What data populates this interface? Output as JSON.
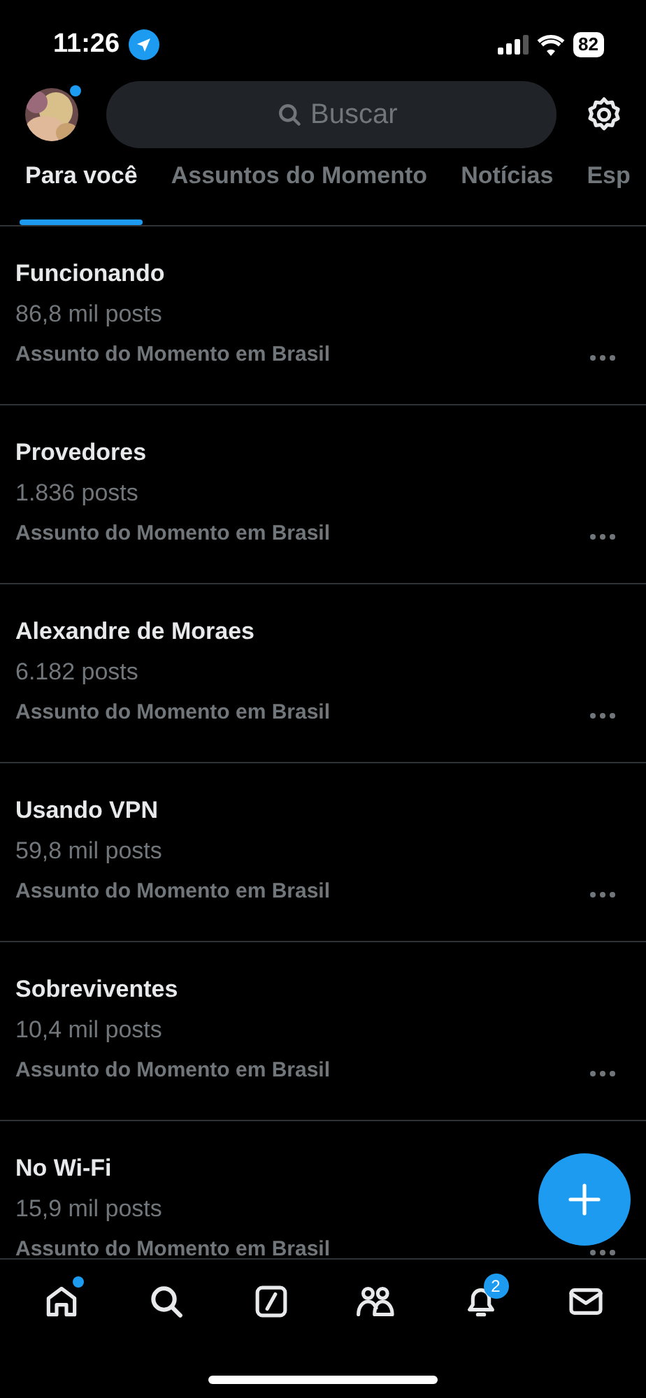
{
  "status_bar": {
    "time": "11:26",
    "battery": "82"
  },
  "header": {
    "avatar": {
      "kind": "picture",
      "dot": true
    },
    "search": {
      "placeholder": "Buscar"
    }
  },
  "tabs": [
    {
      "label": "Para você",
      "selected": true
    },
    {
      "label": "Assuntos do Momento",
      "selected": false
    },
    {
      "label": "Notícias",
      "selected": false
    },
    {
      "label": "Esp",
      "selected": false
    }
  ],
  "trends": [
    {
      "title": "Funcionando",
      "count": "86,8 mil posts",
      "context": "Assunto do Momento em Brasil"
    },
    {
      "title": "Provedores",
      "count": "1.836 posts",
      "context": "Assunto do Momento em Brasil"
    },
    {
      "title": "Alexandre de Moraes",
      "count": "6.182 posts",
      "context": "Assunto do Momento em Brasil"
    },
    {
      "title": "Usando VPN",
      "count": "59,8 mil posts",
      "context": "Assunto do Momento em Brasil"
    },
    {
      "title": "Sobreviventes",
      "count": "10,4 mil posts",
      "context": "Assunto do Momento em Brasil"
    },
    {
      "title": "No Wi-Fi",
      "count": "15,9 mil posts",
      "context": "Assunto do Momento em Brasil"
    }
  ],
  "nav": [
    {
      "kind": "home",
      "dot": true
    },
    {
      "kind": "search",
      "dot": false
    },
    {
      "kind": "grok",
      "dot": false
    },
    {
      "kind": "communities",
      "dot": false
    },
    {
      "kind": "notifications",
      "dot": false,
      "badge": "2"
    },
    {
      "kind": "messages",
      "dot": false
    }
  ]
}
